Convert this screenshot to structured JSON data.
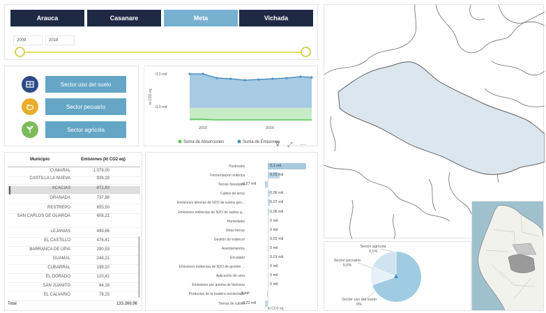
{
  "tabs": [
    {
      "label": "Arauca",
      "active": false
    },
    {
      "label": "Casanare",
      "active": false
    },
    {
      "label": "Meta",
      "active": true
    },
    {
      "label": "Vichada",
      "active": false
    }
  ],
  "year_range": {
    "from": "2009",
    "to": "2018"
  },
  "sectors": [
    {
      "label": "Sector uso del suelo",
      "icon": "land-use-icon",
      "color": "#2e4a86"
    },
    {
      "label": "Sector pecuario",
      "icon": "livestock-icon",
      "color": "#e9ad2c"
    },
    {
      "label": "Sector agrícola",
      "icon": "agriculture-icon",
      "color": "#7dbb5a"
    }
  ],
  "line_chart": {
    "ylabel": "kt CO2 eq",
    "yticks": [
      "0,2 mil",
      "0,0 mil"
    ],
    "xticks": [
      "2010",
      "2016"
    ],
    "legend": [
      "Suma de Absorciones",
      "Suma de Emisiones"
    ],
    "colors": {
      "emisiones": "#4a90c2",
      "absorciones": "#5cc65c"
    }
  },
  "table": {
    "headers": [
      "Municipio",
      "Emisiones (kt CO2 eq)"
    ],
    "rows": [
      {
        "municipio": "CUMARAL",
        "emisiones": "1.079,00"
      },
      {
        "municipio": "CASTILLA LA NUEVA",
        "emisiones": "926,19"
      },
      {
        "municipio": "ACACIAS",
        "emisiones": "872,83"
      },
      {
        "municipio": "GRANADA",
        "emisiones": "737,88"
      },
      {
        "municipio": "RESTREPO",
        "emisiones": "655,50"
      },
      {
        "municipio": "SAN CARLOS DE GUAROA",
        "emisiones": "608,21"
      },
      {
        "municipio": "LEJANIAS",
        "emisiones": "499,66"
      },
      {
        "municipio": "EL CASTILLO",
        "emisiones": "476,41"
      },
      {
        "municipio": "BARRANCA DE UPIA",
        "emisiones": "290,53"
      },
      {
        "municipio": "GUAMAL",
        "emisiones": "244,21"
      },
      {
        "municipio": "CUBARRAL",
        "emisiones": "199,10"
      },
      {
        "municipio": "EL DORADO",
        "emisiones": "120,41"
      },
      {
        "municipio": "SAN JUANITO",
        "emisiones": "84,18"
      },
      {
        "municipio": "EL CALVARIO",
        "emisiones": "78,23"
      }
    ],
    "total_label": "Total",
    "total_value": "133.266,96"
  },
  "bar_chart": {
    "axis_label": "kt CO2 eq",
    "items": [
      {
        "label": "Pastizales",
        "value": 0.1,
        "text": "0,1 mil"
      },
      {
        "label": "Fermentación entérica",
        "value": 0.03,
        "text": "0,03 mil"
      },
      {
        "label": "Tierras forestales",
        "value": -0.27,
        "text": "-0,27 mil"
      },
      {
        "label": "Cultivo de arroz",
        "value": 0.006,
        "text": "0,06 mil"
      },
      {
        "label": "Emisiones directas de N2O de suelos ges...",
        "value": 0.005,
        "text": "0,07 mil"
      },
      {
        "label": "Emisiones indirectas de N2O de suelos g...",
        "value": 0.004,
        "text": "0,06 mil"
      },
      {
        "label": "Humedales",
        "value": 0.002,
        "text": "0 mil"
      },
      {
        "label": "Otras tierras",
        "value": 0.002,
        "text": "0 mil"
      },
      {
        "label": "Gestión de estiércol",
        "value": 0.002,
        "text": "0,02 mil"
      },
      {
        "label": "Asentamientos",
        "value": 0.001,
        "text": "0 mil"
      },
      {
        "label": "Encalado",
        "value": 0.001,
        "text": "0,01 mil"
      },
      {
        "label": "Emisiones indirectas de N2O de gestión ...",
        "value": 0.001,
        "text": "0 mil"
      },
      {
        "label": "Aplicación de urea",
        "value": 0.001,
        "text": "0 mil"
      },
      {
        "label": "Emisiones por quema de biomasa",
        "value": 0.001,
        "text": "0 mil"
      },
      {
        "label": "Productos de la madera recolectada",
        "value": -0.001,
        "text": "0 mil"
      },
      {
        "label": "Tierras de cultivo",
        "value": -0.22,
        "text": "-0,22 mil"
      }
    ]
  },
  "pie": {
    "labels": [
      {
        "name": "Sector agrícola",
        "pct": "0,1%"
      },
      {
        "name": "Sector pecuario",
        "pct": "0,0%"
      },
      {
        "name": "Sector uso del suelo",
        "pct": "0%"
      }
    ],
    "colors": [
      "#9fcbe3",
      "#cfe3f0",
      "#e6f0f7"
    ]
  },
  "map": {
    "highlight_color": "#dbe6ee",
    "border_color": "#6b6b6b"
  }
}
